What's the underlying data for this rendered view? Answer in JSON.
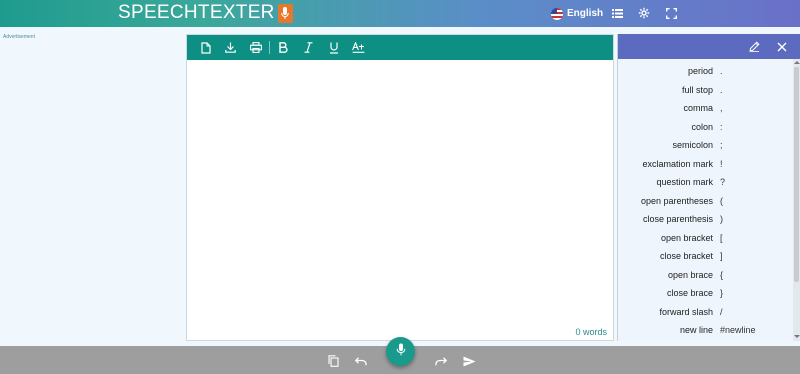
{
  "header": {
    "logo_text": "SPEECHTEXTER",
    "language": "English",
    "icons": [
      "flag-us-icon",
      "list-icon",
      "gear-icon",
      "fullscreen-icon"
    ]
  },
  "ad": {
    "label": "Advertisement"
  },
  "editor": {
    "toolbar_icons": [
      "new-document-icon",
      "download-icon",
      "print-icon",
      "bold-icon",
      "italic-icon",
      "underline-icon",
      "text-format-icon"
    ],
    "content": "",
    "word_count": "0 words"
  },
  "panel": {
    "icons": [
      "edit-icon",
      "close-icon"
    ],
    "commands": [
      {
        "name": "period",
        "value": "."
      },
      {
        "name": "full stop",
        "value": "."
      },
      {
        "name": "comma",
        "value": ","
      },
      {
        "name": "colon",
        "value": ":"
      },
      {
        "name": "semicolon",
        "value": ";"
      },
      {
        "name": "exclamation mark",
        "value": "!"
      },
      {
        "name": "question mark",
        "value": "?"
      },
      {
        "name": "open parentheses",
        "value": "("
      },
      {
        "name": "close parenthesis",
        "value": ")"
      },
      {
        "name": "open bracket",
        "value": "["
      },
      {
        "name": "close bracket",
        "value": "]"
      },
      {
        "name": "open brace",
        "value": "{"
      },
      {
        "name": "close brace",
        "value": "}"
      },
      {
        "name": "forward slash",
        "value": "/"
      },
      {
        "name": "new line",
        "value": "#newline"
      }
    ]
  },
  "bottom": {
    "icons": [
      "copy-icon",
      "undo-icon",
      "microphone-icon",
      "redo-icon",
      "send-icon"
    ]
  },
  "colors": {
    "toolbar": "#0d8f83",
    "panel_header": "#5c6bc0",
    "logo_mic": "#e8772e",
    "bottom_bar": "#9e9e9e",
    "mic_button": "#1a9a8c"
  }
}
